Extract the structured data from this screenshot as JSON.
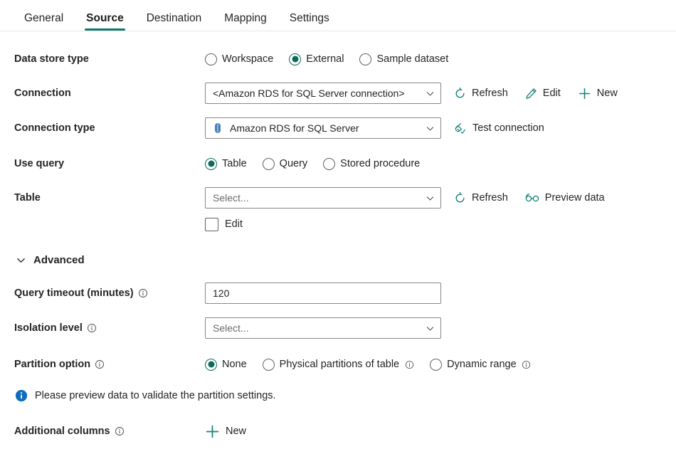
{
  "tabs": [
    {
      "label": "General",
      "active": false
    },
    {
      "label": "Source",
      "active": true
    },
    {
      "label": "Destination",
      "active": false
    },
    {
      "label": "Mapping",
      "active": false
    },
    {
      "label": "Settings",
      "active": false
    }
  ],
  "colors": {
    "accent_green": "#0f7b6c",
    "radio_selected": "#0b6a5a",
    "action_icon_teal": "#17807a",
    "info_blue": "#0f6cbd",
    "db_icon_blue": "#4a7ebb",
    "field_border": "#8a8886"
  },
  "data_store_type": {
    "label": "Data store type",
    "options": [
      {
        "label": "Workspace",
        "selected": false
      },
      {
        "label": "External",
        "selected": true
      },
      {
        "label": "Sample dataset",
        "selected": false
      }
    ]
  },
  "connection": {
    "label": "Connection",
    "value": "<Amazon RDS for SQL Server connection>",
    "actions": [
      {
        "label": "Refresh",
        "icon": "refresh-icon"
      },
      {
        "label": "Edit",
        "icon": "pencil-icon"
      },
      {
        "label": "New",
        "icon": "plus-icon"
      }
    ]
  },
  "connection_type": {
    "label": "Connection type",
    "value": "Amazon RDS for SQL Server",
    "icon": "database-icon",
    "action": {
      "label": "Test connection",
      "icon": "plug-check-icon"
    }
  },
  "use_query": {
    "label": "Use query",
    "options": [
      {
        "label": "Table",
        "selected": true
      },
      {
        "label": "Query",
        "selected": false
      },
      {
        "label": "Stored procedure",
        "selected": false
      }
    ]
  },
  "table": {
    "label": "Table",
    "placeholder": "Select...",
    "value": "",
    "actions": [
      {
        "label": "Refresh",
        "icon": "refresh-icon"
      },
      {
        "label": "Preview data",
        "icon": "glasses-icon"
      }
    ],
    "edit_checkbox": {
      "label": "Edit",
      "checked": false
    }
  },
  "advanced": {
    "label": "Advanced",
    "expanded": true
  },
  "query_timeout": {
    "label": "Query timeout (minutes)",
    "value": "120",
    "has_info": true
  },
  "isolation_level": {
    "label": "Isolation level",
    "placeholder": "Select...",
    "value": "",
    "has_info": true
  },
  "partition_option": {
    "label": "Partition option",
    "has_info": true,
    "options": [
      {
        "label": "None",
        "selected": true,
        "has_info": false
      },
      {
        "label": "Physical partitions of table",
        "selected": false,
        "has_info": true
      },
      {
        "label": "Dynamic range",
        "selected": false,
        "has_info": true
      }
    ]
  },
  "info_message": {
    "text": "Please preview data to validate the partition settings.",
    "icon": "info-filled-icon"
  },
  "additional_columns": {
    "label": "Additional columns",
    "has_info": true,
    "action": {
      "label": "New",
      "icon": "plus-icon"
    }
  }
}
